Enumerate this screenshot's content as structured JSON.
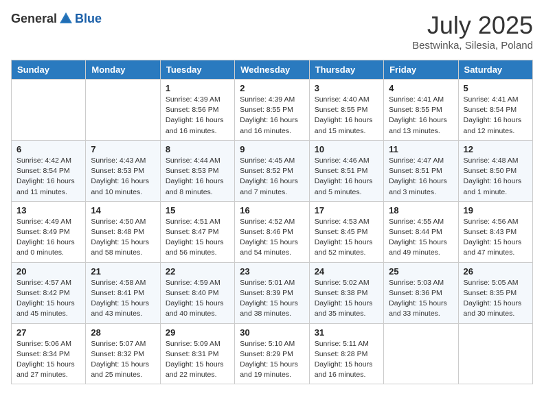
{
  "header": {
    "logo_general": "General",
    "logo_blue": "Blue",
    "month": "July 2025",
    "location": "Bestwinka, Silesia, Poland"
  },
  "days_of_week": [
    "Sunday",
    "Monday",
    "Tuesday",
    "Wednesday",
    "Thursday",
    "Friday",
    "Saturday"
  ],
  "weeks": [
    [
      {
        "num": "",
        "info": ""
      },
      {
        "num": "",
        "info": ""
      },
      {
        "num": "1",
        "info": "Sunrise: 4:39 AM\nSunset: 8:56 PM\nDaylight: 16 hours and 16 minutes."
      },
      {
        "num": "2",
        "info": "Sunrise: 4:39 AM\nSunset: 8:55 PM\nDaylight: 16 hours and 16 minutes."
      },
      {
        "num": "3",
        "info": "Sunrise: 4:40 AM\nSunset: 8:55 PM\nDaylight: 16 hours and 15 minutes."
      },
      {
        "num": "4",
        "info": "Sunrise: 4:41 AM\nSunset: 8:55 PM\nDaylight: 16 hours and 13 minutes."
      },
      {
        "num": "5",
        "info": "Sunrise: 4:41 AM\nSunset: 8:54 PM\nDaylight: 16 hours and 12 minutes."
      }
    ],
    [
      {
        "num": "6",
        "info": "Sunrise: 4:42 AM\nSunset: 8:54 PM\nDaylight: 16 hours and 11 minutes."
      },
      {
        "num": "7",
        "info": "Sunrise: 4:43 AM\nSunset: 8:53 PM\nDaylight: 16 hours and 10 minutes."
      },
      {
        "num": "8",
        "info": "Sunrise: 4:44 AM\nSunset: 8:53 PM\nDaylight: 16 hours and 8 minutes."
      },
      {
        "num": "9",
        "info": "Sunrise: 4:45 AM\nSunset: 8:52 PM\nDaylight: 16 hours and 7 minutes."
      },
      {
        "num": "10",
        "info": "Sunrise: 4:46 AM\nSunset: 8:51 PM\nDaylight: 16 hours and 5 minutes."
      },
      {
        "num": "11",
        "info": "Sunrise: 4:47 AM\nSunset: 8:51 PM\nDaylight: 16 hours and 3 minutes."
      },
      {
        "num": "12",
        "info": "Sunrise: 4:48 AM\nSunset: 8:50 PM\nDaylight: 16 hours and 1 minute."
      }
    ],
    [
      {
        "num": "13",
        "info": "Sunrise: 4:49 AM\nSunset: 8:49 PM\nDaylight: 16 hours and 0 minutes."
      },
      {
        "num": "14",
        "info": "Sunrise: 4:50 AM\nSunset: 8:48 PM\nDaylight: 15 hours and 58 minutes."
      },
      {
        "num": "15",
        "info": "Sunrise: 4:51 AM\nSunset: 8:47 PM\nDaylight: 15 hours and 56 minutes."
      },
      {
        "num": "16",
        "info": "Sunrise: 4:52 AM\nSunset: 8:46 PM\nDaylight: 15 hours and 54 minutes."
      },
      {
        "num": "17",
        "info": "Sunrise: 4:53 AM\nSunset: 8:45 PM\nDaylight: 15 hours and 52 minutes."
      },
      {
        "num": "18",
        "info": "Sunrise: 4:55 AM\nSunset: 8:44 PM\nDaylight: 15 hours and 49 minutes."
      },
      {
        "num": "19",
        "info": "Sunrise: 4:56 AM\nSunset: 8:43 PM\nDaylight: 15 hours and 47 minutes."
      }
    ],
    [
      {
        "num": "20",
        "info": "Sunrise: 4:57 AM\nSunset: 8:42 PM\nDaylight: 15 hours and 45 minutes."
      },
      {
        "num": "21",
        "info": "Sunrise: 4:58 AM\nSunset: 8:41 PM\nDaylight: 15 hours and 43 minutes."
      },
      {
        "num": "22",
        "info": "Sunrise: 4:59 AM\nSunset: 8:40 PM\nDaylight: 15 hours and 40 minutes."
      },
      {
        "num": "23",
        "info": "Sunrise: 5:01 AM\nSunset: 8:39 PM\nDaylight: 15 hours and 38 minutes."
      },
      {
        "num": "24",
        "info": "Sunrise: 5:02 AM\nSunset: 8:38 PM\nDaylight: 15 hours and 35 minutes."
      },
      {
        "num": "25",
        "info": "Sunrise: 5:03 AM\nSunset: 8:36 PM\nDaylight: 15 hours and 33 minutes."
      },
      {
        "num": "26",
        "info": "Sunrise: 5:05 AM\nSunset: 8:35 PM\nDaylight: 15 hours and 30 minutes."
      }
    ],
    [
      {
        "num": "27",
        "info": "Sunrise: 5:06 AM\nSunset: 8:34 PM\nDaylight: 15 hours and 27 minutes."
      },
      {
        "num": "28",
        "info": "Sunrise: 5:07 AM\nSunset: 8:32 PM\nDaylight: 15 hours and 25 minutes."
      },
      {
        "num": "29",
        "info": "Sunrise: 5:09 AM\nSunset: 8:31 PM\nDaylight: 15 hours and 22 minutes."
      },
      {
        "num": "30",
        "info": "Sunrise: 5:10 AM\nSunset: 8:29 PM\nDaylight: 15 hours and 19 minutes."
      },
      {
        "num": "31",
        "info": "Sunrise: 5:11 AM\nSunset: 8:28 PM\nDaylight: 15 hours and 16 minutes."
      },
      {
        "num": "",
        "info": ""
      },
      {
        "num": "",
        "info": ""
      }
    ]
  ]
}
